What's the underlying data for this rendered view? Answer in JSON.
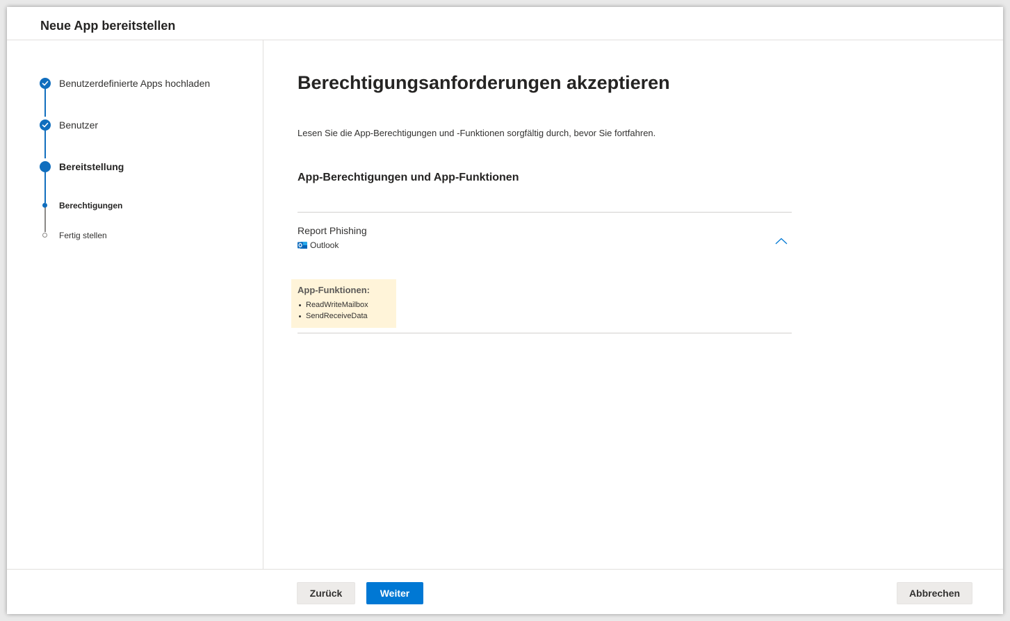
{
  "dialog": {
    "title": "Neue App bereitstellen"
  },
  "steps": [
    {
      "label": "Benutzerdefinierte Apps hochladen",
      "state": "completed"
    },
    {
      "label": "Benutzer",
      "state": "completed"
    },
    {
      "label": "Bereitstellung",
      "state": "current"
    },
    {
      "label": "Berechtigungen",
      "state": "current-substep"
    },
    {
      "label": "Fertig stellen",
      "state": "future-substep"
    }
  ],
  "main": {
    "title": "Berechtigungsanforderungen akzeptieren",
    "description": "Lesen Sie die App-Berechtigungen und -Funktionen sorgfältig durch, bevor Sie fortfahren.",
    "section_heading": "App-Berechtigungen und App-Funktionen",
    "app": {
      "name": "Report Phishing",
      "host": "Outlook",
      "host_icon": "outlook-icon",
      "functions_title": "App-Funktionen:",
      "functions": [
        "ReadWriteMailbox",
        "SendReceiveData"
      ]
    }
  },
  "footer": {
    "back_label": "Zurück",
    "next_label": "Weiter",
    "cancel_label": "Abbrechen"
  },
  "colors": {
    "accent": "#0078d4",
    "highlight": "#fff4d9"
  }
}
